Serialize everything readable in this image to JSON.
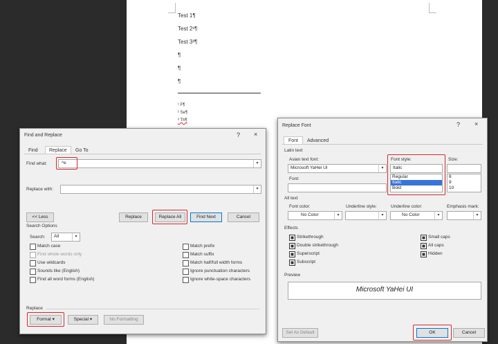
{
  "document": {
    "lines": [
      "Test 1¶",
      "Test 2¹¶",
      "Test 3²¶",
      "¶",
      "¶",
      "¶"
    ],
    "footnote_lines": [
      "¹ F¶",
      "² Se¶",
      "³ Th¶"
    ]
  },
  "find_replace": {
    "title": "Find and Replace",
    "title_help": "?",
    "title_close": "×",
    "tabs": [
      "Find",
      "Replace",
      "Go To"
    ],
    "find_what_label": "Find what:",
    "find_what_value": "^e",
    "replace_with_label": "Replace with:",
    "replace_with_value": "",
    "less_button": "<< Less",
    "replace_button": "Replace",
    "replace_all_button": "Replace All",
    "find_next_button": "Find Next",
    "cancel_button": "Cancel",
    "search_options_label": "Search Options",
    "search_label": "Search:",
    "search_value": "All",
    "options_left": [
      {
        "label": "Match case",
        "checked": false,
        "disabled": false
      },
      {
        "label": "Find whole words only",
        "checked": false,
        "disabled": true
      },
      {
        "label": "Use wildcards",
        "checked": false,
        "disabled": false
      },
      {
        "label": "Sounds like (English)",
        "checked": false,
        "disabled": false
      },
      {
        "label": "Find all word forms (English)",
        "checked": false,
        "disabled": false
      }
    ],
    "options_right": [
      {
        "label": "Match prefix",
        "checked": false
      },
      {
        "label": "Match suffix",
        "checked": false
      },
      {
        "label": "Match half/full width forms",
        "checked": false
      },
      {
        "label": "Ignore punctuation characters",
        "checked": false
      },
      {
        "label": "Ignore white-space characters",
        "checked": false
      }
    ],
    "replace_section_label": "Replace",
    "format_button": "Format ▾",
    "special_button": "Special ▾",
    "no_formatting_button": "No Formatting"
  },
  "replace_font": {
    "title": "Replace Font",
    "title_help": "?",
    "title_close": "×",
    "tabs": [
      "Font",
      "Advanced"
    ],
    "latin_text_label": "Latin text",
    "asian_font_label": "Asian text font:",
    "asian_font_value": "Microsoft YaHei UI",
    "font_label": "Font:",
    "font_value": "",
    "font_style_label": "Font style:",
    "font_style_value": "Italic",
    "font_style_options": [
      "Regular",
      "Italic",
      "Bold"
    ],
    "font_style_selected": "Italic",
    "size_label": "Size:",
    "size_value": "",
    "size_options": [
      "8",
      "9",
      "10"
    ],
    "all_text_label": "All text",
    "font_color_label": "Font color:",
    "font_color_value": "No Color",
    "underline_style_label": "Underline style:",
    "underline_style_value": "",
    "underline_color_label": "Underline color:",
    "underline_color_value": "No Color",
    "emphasis_mark_label": "Emphasis mark:",
    "emphasis_mark_value": "",
    "effects_label": "Effects",
    "effects_left": [
      "Strikethrough",
      "Double strikethrough",
      "Superscript",
      "Subscript"
    ],
    "effects_right": [
      "Small caps",
      "All caps",
      "Hidden"
    ],
    "preview_label": "Preview",
    "preview_text": "Microsoft YaHei UI",
    "set_default_button": "Set As Default",
    "ok_button": "OK",
    "cancel_button": "Cancel"
  }
}
